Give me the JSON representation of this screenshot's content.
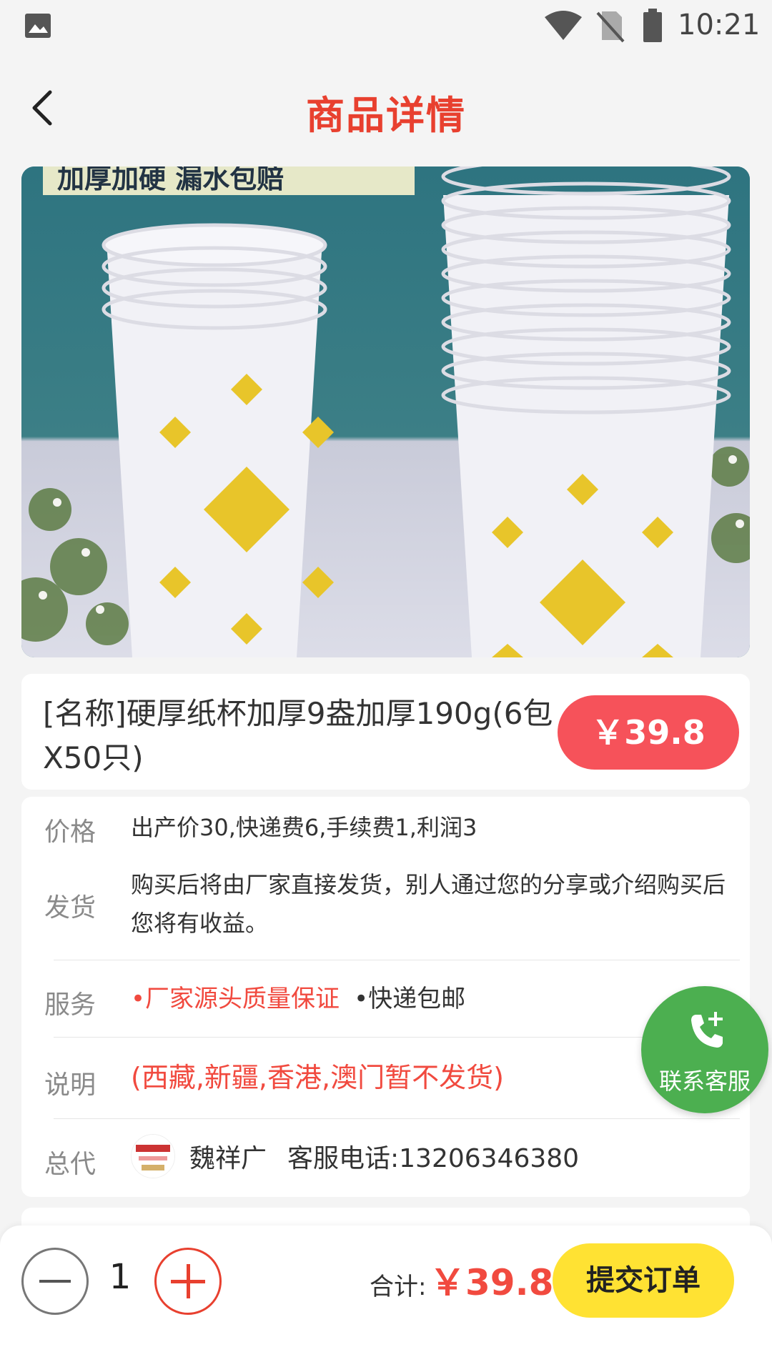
{
  "status_bar": {
    "time": "10:21"
  },
  "header": {
    "title": "商品详情"
  },
  "product": {
    "name": "[名称]硬厚纸杯加厚9盎加厚190g(6包X50只)",
    "price": "￥39.8",
    "image_banner_text": "加厚加硬 漏水包赔"
  },
  "details": {
    "price_label": "价格",
    "price_text": "出产价30,快递费6,手续费1,利润3",
    "shipping_label": "发货",
    "shipping_text": "购买后将由厂家直接发货，别人通过您的分享或介绍购买后您将有收益。",
    "service_label": "服务",
    "service_item_1": "•厂家源头质量保证",
    "service_item_2": "•快递包邮",
    "note_label": "说明",
    "note_text": "(西藏,新疆,香港,澳门暂不发货)",
    "agent_label": "总代",
    "agent_name": "魏祥广",
    "agent_phone": "客服电话:13206346380"
  },
  "contact_fab": {
    "label": "联系客服"
  },
  "order_bar": {
    "quantity": "1",
    "total_label": "合计:",
    "total_value": "￥39.8",
    "submit_label": "提交订单"
  },
  "colors": {
    "title_red": "#e8402f",
    "price_pill": "#f6525a",
    "fab_green": "#4caf50",
    "submit_yellow": "#ffe233"
  }
}
